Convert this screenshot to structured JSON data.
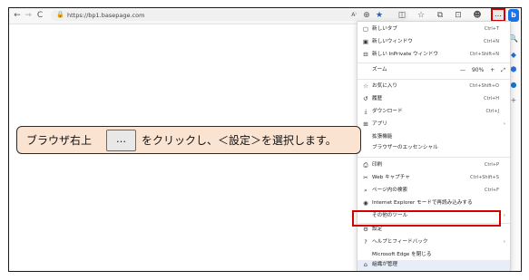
{
  "browser": {
    "url": "https://bp1.basepage.com",
    "toolbar_icons": [
      "back-icon",
      "forward-icon",
      "refresh-icon",
      "read-aloud-icon",
      "zoom-icon",
      "favorite-star-icon",
      "split-screen-icon",
      "favorites-icon",
      "collections-icon",
      "extensions-icon",
      "profile-icon"
    ],
    "toolbar_glyphs": [
      "←",
      "→",
      "C",
      "A⁾",
      "⊕",
      "★",
      "◫",
      "☆",
      "⧉",
      "⊡",
      "☻"
    ],
    "dots_label": "…",
    "bing_label": "b",
    "accent_red": "#d40000"
  },
  "sidebar": {
    "glyphs": [
      "🔍",
      "◆",
      "⬢",
      "●",
      "+"
    ],
    "names": [
      "search-icon",
      "tag-icon",
      "office-icon",
      "outlook-icon",
      "add-icon"
    ]
  },
  "menu": {
    "items": [
      {
        "id": "new-tab",
        "icon": "▢",
        "label": "新しいタブ",
        "shortcut": "Ctrl+T"
      },
      {
        "id": "new-window",
        "icon": "▣",
        "label": "新しいウィンドウ",
        "shortcut": "Ctrl+N"
      },
      {
        "id": "new-inprivate",
        "icon": "⊟",
        "label": "新しい InPrivate ウィンドウ",
        "shortcut": "Ctrl+Shift+N"
      },
      {
        "id": "zoom",
        "icon": "",
        "label": "ズーム",
        "zoom_minus": "—",
        "zoom_value": "90%",
        "zoom_plus": "+",
        "zoom_full": "⤢"
      },
      {
        "id": "favorites",
        "icon": "☆",
        "label": "お気に入り",
        "shortcut": "Ctrl+Shift+O"
      },
      {
        "id": "history",
        "icon": "↺",
        "label": "履歴",
        "shortcut": "Ctrl+H"
      },
      {
        "id": "downloads",
        "icon": "⤓",
        "label": "ダウンロード",
        "shortcut": "Ctrl+J"
      },
      {
        "id": "apps",
        "icon": "⊞",
        "label": "アプリ",
        "arrow": "›"
      },
      {
        "id": "extensions",
        "icon": "",
        "label": "拡張機能"
      },
      {
        "id": "essentials",
        "icon": "",
        "label": "ブラウザーのエッセンシャル"
      },
      {
        "id": "print",
        "icon": "⎙",
        "label": "印刷",
        "shortcut": "Ctrl+P"
      },
      {
        "id": "web-capture",
        "icon": "✂",
        "label": "Web キャプチャ",
        "shortcut": "Ctrl+Shift+S"
      },
      {
        "id": "find",
        "icon": "⌕",
        "label": "ページ内の検索",
        "shortcut": "Ctrl+F"
      },
      {
        "id": "ie-mode",
        "icon": "◉",
        "label": "Internet Explorer モードで再読み込みする"
      },
      {
        "id": "more-tools",
        "icon": "",
        "label": "その他のツール",
        "arrow": "›"
      },
      {
        "id": "settings",
        "icon": "⚙",
        "label": "設定"
      },
      {
        "id": "help",
        "icon": "?",
        "label": "ヘルプとフィードバック",
        "arrow": "›"
      },
      {
        "id": "close-edge",
        "icon": "",
        "label": "Microsoft Edge を閉じる"
      },
      {
        "id": "managed",
        "icon": "⌂",
        "label": "組織が管理"
      }
    ]
  },
  "callout": {
    "text_before": "ブラウザ右上",
    "button_label": "…",
    "text_after": "をクリックし、＜設定＞を選択します。",
    "bg_color": "#fbe3d2"
  }
}
